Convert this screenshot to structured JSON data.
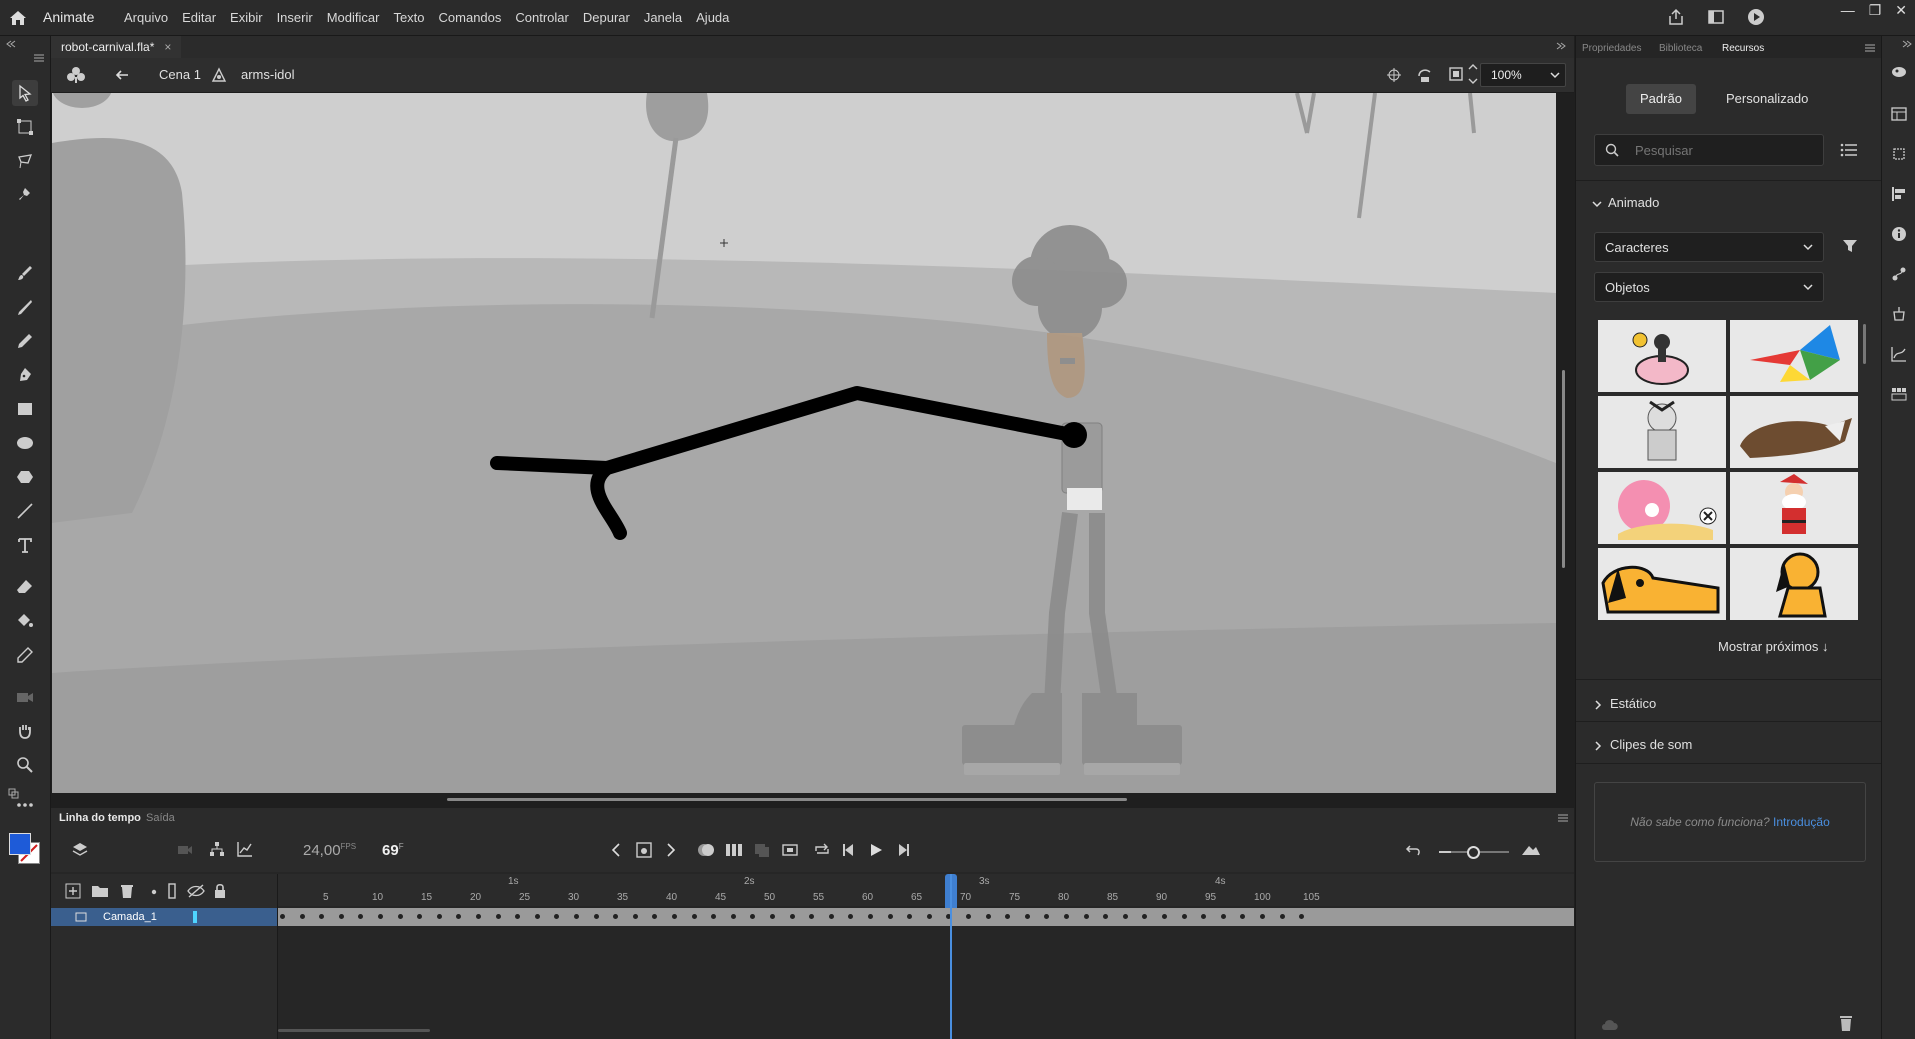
{
  "app": {
    "name": "Animate"
  },
  "menu": [
    "Arquivo",
    "Editar",
    "Exibir",
    "Inserir",
    "Modificar",
    "Texto",
    "Comandos",
    "Controlar",
    "Depurar",
    "Janela",
    "Ajuda"
  ],
  "window_controls": [
    "—",
    "❐",
    "✕"
  ],
  "document": {
    "tab_name": "robot-carnival.fla*",
    "close": "×"
  },
  "editbar": {
    "scene": "Cena 1",
    "symbol": "arms-idol",
    "zoom": "100%"
  },
  "timeline": {
    "tab_active": "Linha do tempo",
    "tab_inactive": "Saída",
    "fps": "24,00",
    "fps_unit": "FPS",
    "current_frame": "69",
    "frame_unit": "F",
    "layer_name": "Camada_1",
    "ruler_seconds": [
      "1s",
      "2s",
      "3s",
      "4s"
    ],
    "ruler_frames": [
      "5",
      "10",
      "15",
      "20",
      "25",
      "30",
      "35",
      "40",
      "45",
      "50",
      "55",
      "60",
      "65",
      "70",
      "75",
      "80",
      "85",
      "90",
      "95",
      "100",
      "105"
    ]
  },
  "right_panel": {
    "tabs": [
      "Propriedades",
      "Biblioteca",
      "Recursos"
    ],
    "active_tab": "Recursos",
    "segment": [
      "Padrão",
      "Personalizado"
    ],
    "search_placeholder": "Pesquisar",
    "section_animado": "Animado",
    "dropdown_1": "Caracteres",
    "dropdown_2": "Objetos",
    "show_more": "Mostrar próximos ↓",
    "section_static": "Estático",
    "section_sound": "Clipes de som",
    "help_text": "Não sabe como funciona?",
    "help_link": "Introdução"
  },
  "colors": {
    "accent": "#4a8fe0",
    "stroke_color": "#1e5bd8",
    "fill_color": "#d01e1e"
  }
}
